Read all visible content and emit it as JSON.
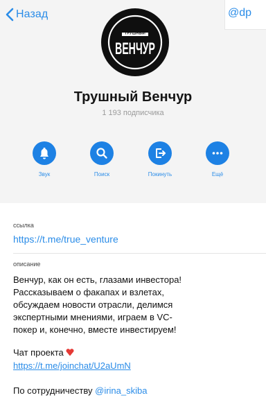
{
  "nav": {
    "back_label": "Назад"
  },
  "peek": {
    "text": "@dp"
  },
  "logo": {
    "line1": "ТРУШНЫЙ",
    "line2": "ВЕНЧУР"
  },
  "channel": {
    "title": "Трушный Венчур",
    "subscribers": "1 193 подписчика"
  },
  "actions": [
    {
      "label": "Звук",
      "icon": "bell-icon"
    },
    {
      "label": "Поиск",
      "icon": "search-icon"
    },
    {
      "label": "Покинуть",
      "icon": "leave-icon"
    },
    {
      "label": "Ещё",
      "icon": "more-icon"
    }
  ],
  "info": {
    "link_label": "ссылка",
    "link": "https://t.me/true_venture",
    "description_label": "описание",
    "description_lines": [
      "Венчур, как он есть, глазами инвестора!",
      "Рассказываем о факапах и взлетах,",
      "обсуждаем новости отрасли, делимся",
      "экспертными мнениями, играем в VC-",
      "покер и, конечно, вместе инвестируем!"
    ],
    "chat_label": "Чат проекта",
    "chat_link": "https://t.me/joinchat/U2aUmN",
    "collab_prefix": "По сотрудничеству",
    "collab_handle": "@irina_skiba"
  },
  "colors": {
    "accent": "#1d81e4",
    "link": "#2a8ce8",
    "header_bg": "#f4f4f4",
    "heart": "#e53935"
  }
}
